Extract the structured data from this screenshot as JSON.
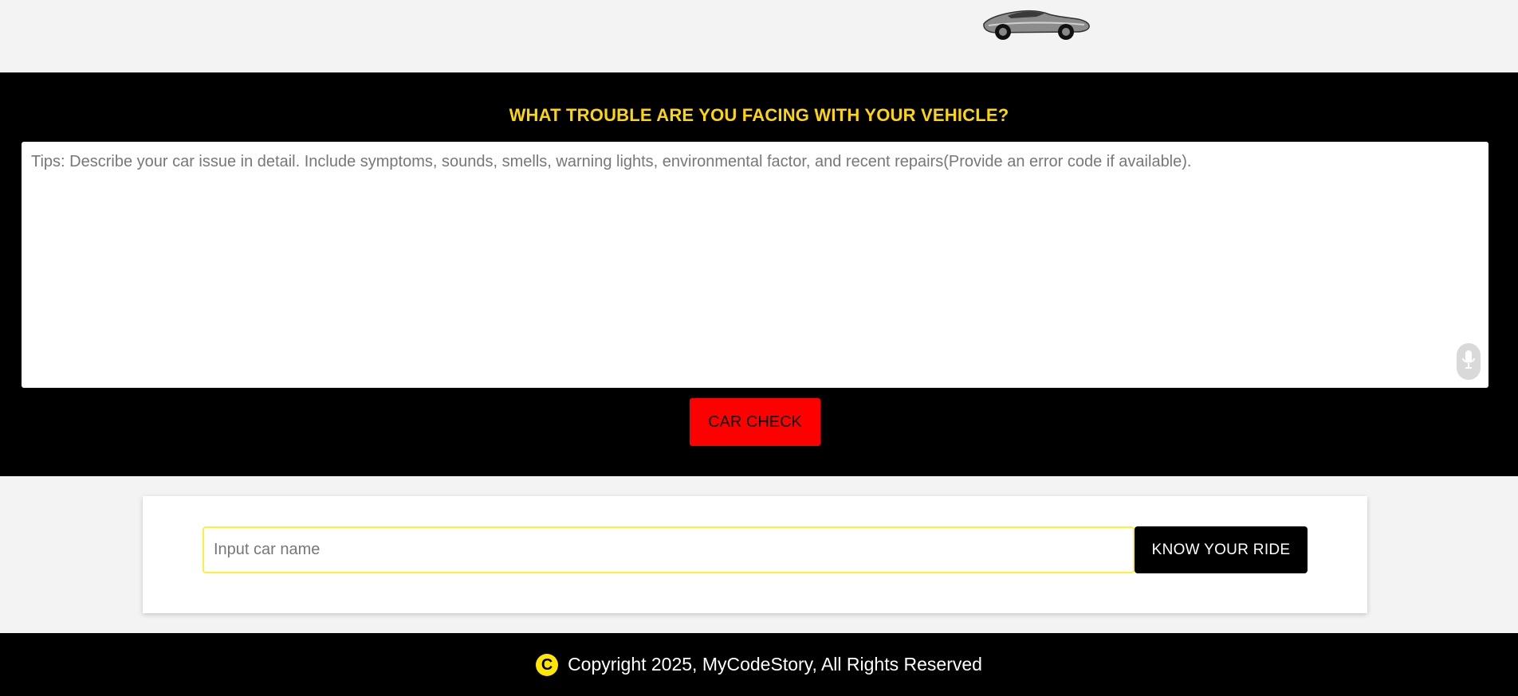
{
  "header": {
    "logo_icon": "car-logo-icon"
  },
  "hero": {
    "title": "WHAT TROUBLE ARE YOU FACING WITH YOUR VEHICLE?",
    "issue_placeholder": "Tips: Describe your car issue in detail. Include symptoms, sounds, smells, warning lights, environmental factor, and recent repairs(Provide an error code if available).",
    "issue_value": "",
    "mic_icon": "microphone-icon",
    "check_button_label": "CAR CHECK"
  },
  "search": {
    "placeholder": "Input car name",
    "value": "",
    "button_label": "KNOW YOUR RIDE"
  },
  "footer": {
    "copyright_symbol": "C",
    "text": "Copyright 2025, MyCodeStory, All Rights Reserved"
  },
  "colors": {
    "page_background": "#f3f3f3",
    "hero_background": "#000000",
    "title_accent": "#ffd700",
    "check_button": "#ff0000",
    "input_border": "#ffef3a",
    "copyright_icon": "#ffe600"
  }
}
